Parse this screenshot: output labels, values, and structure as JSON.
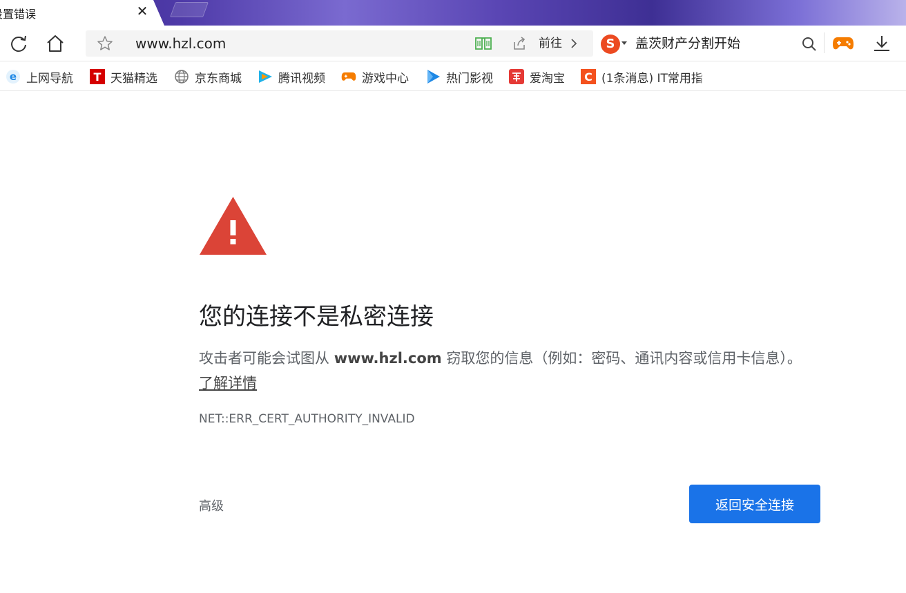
{
  "tab": {
    "title": "设置错误",
    "close_glyph": "✕"
  },
  "toolbar": {
    "url": "www.hzl.com",
    "go_label": "前往",
    "search_engine_letter": "S",
    "search_query": "盖茨财产分割开始"
  },
  "icons": {
    "reload": "reload-icon",
    "home": "home-icon",
    "star": "star-icon",
    "reader": "book-icon",
    "share": "share-icon",
    "search": "search-icon",
    "game": "gamepad-icon",
    "download": "download-icon"
  },
  "bookmarks": [
    {
      "label": "上网导航",
      "icon": "ie-icon",
      "color": "#1e88e5"
    },
    {
      "label": "天猫精选",
      "icon": "tmall-icon",
      "color": "#d50000"
    },
    {
      "label": "京东商城",
      "icon": "globe-icon",
      "color": "#666666"
    },
    {
      "label": "腾讯视频",
      "icon": "tencent-video-icon",
      "color": "#20b2e8"
    },
    {
      "label": "游戏中心",
      "icon": "gamepad-icon",
      "color": "#f57c00"
    },
    {
      "label": "热门影视",
      "icon": "play-icon",
      "color": "#1e88e5"
    },
    {
      "label": "爱淘宝",
      "icon": "taobao-icon",
      "color": "#e53935"
    },
    {
      "label": "(1条消息) IT常用指",
      "icon": "csdn-icon",
      "color": "#f4511e"
    }
  ],
  "error": {
    "title": "您的连接不是私密连接",
    "desc_before": "攻击者可能会试图从 ",
    "desc_host": "www.hzl.com",
    "desc_after": " 窃取您的信息（例如：密码、通讯内容或信用卡信息）。",
    "learn_more": "了解详情",
    "code": "NET::ERR_CERT_AUTHORITY_INVALID",
    "advanced_label": "高级",
    "back_button_label": "返回安全连接"
  },
  "colors": {
    "warning_red": "#db4437",
    "primary_blue": "#1a73e8",
    "tab_strip": "#4e3aa8"
  }
}
